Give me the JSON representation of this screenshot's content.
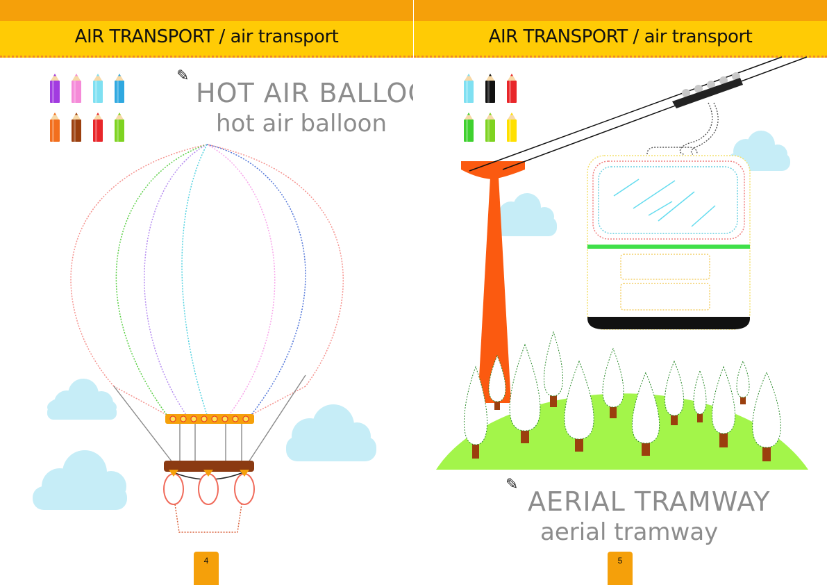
{
  "pages": [
    {
      "header": "AIR TRANSPORT / air transport",
      "title_upper": "HOT AIR BALLOON",
      "title_lower": "hot air balloon",
      "page_number": "4",
      "pencil_colors": [
        "#a23be0",
        "#f58ad8",
        "#7fe0f2",
        "#2fa8e0",
        "#f26f1e",
        "#9b3f0e",
        "#e8262a",
        "#7ed321"
      ]
    },
    {
      "header": "AIR TRANSPORT / air transport",
      "title_upper": "AERIAL TRAMWAY",
      "title_lower": "aerial tramway",
      "page_number": "5",
      "pencil_colors": [
        "#7fe0f2",
        "#111111",
        "#e8262a",
        "#3fd12f",
        "#7ed321",
        "#ffe000"
      ]
    }
  ],
  "icons": {
    "edit": "pencil-icon"
  }
}
